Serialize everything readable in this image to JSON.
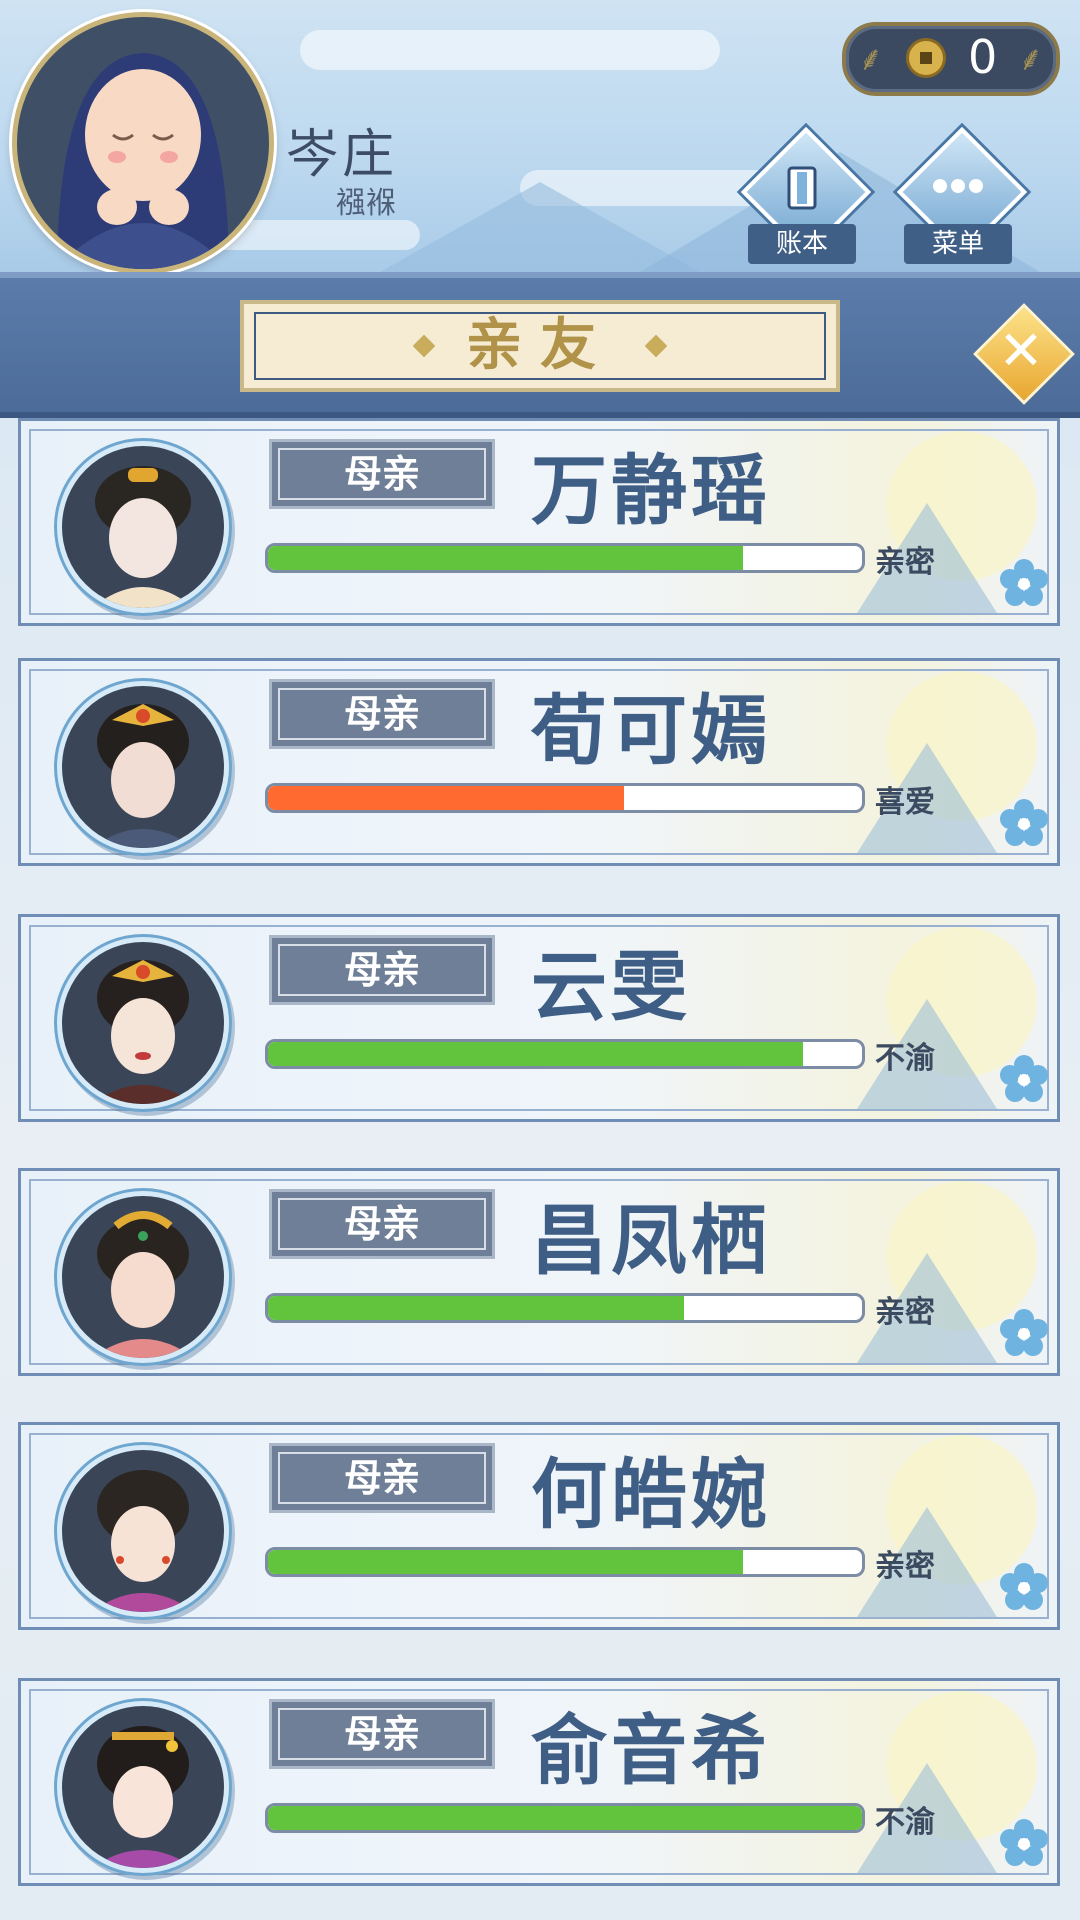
{
  "header": {
    "player_name": "岑庄",
    "player_status": "襁褓",
    "coins": "0",
    "buttons": [
      {
        "label": "账本",
        "icon": "ledger-icon"
      },
      {
        "label": "菜单",
        "icon": "more-icon"
      }
    ]
  },
  "title": {
    "text": "亲友",
    "close_icon": "close-icon"
  },
  "colors": {
    "bar_green": "#62c33d",
    "bar_orange": "#ff6a30",
    "name_blue": "#3f5e86",
    "title_gold": "#b09248"
  },
  "relatives": [
    {
      "relation": "母亲",
      "name": "万静瑶",
      "favor": 0.8,
      "bar_color": "#62c33d",
      "status": "亲密"
    },
    {
      "relation": "母亲",
      "name": "荀可嫣",
      "favor": 0.6,
      "bar_color": "#ff6a30",
      "status": "喜爱"
    },
    {
      "relation": "母亲",
      "name": "云雯",
      "favor": 0.9,
      "bar_color": "#62c33d",
      "status": "不渝"
    },
    {
      "relation": "母亲",
      "name": "昌凤栖",
      "favor": 0.7,
      "bar_color": "#62c33d",
      "status": "亲密"
    },
    {
      "relation": "母亲",
      "name": "何皓婉",
      "favor": 0.8,
      "bar_color": "#62c33d",
      "status": "亲密"
    },
    {
      "relation": "母亲",
      "name": "俞音希",
      "favor": 1.0,
      "bar_color": "#62c33d",
      "status": "不渝"
    }
  ]
}
